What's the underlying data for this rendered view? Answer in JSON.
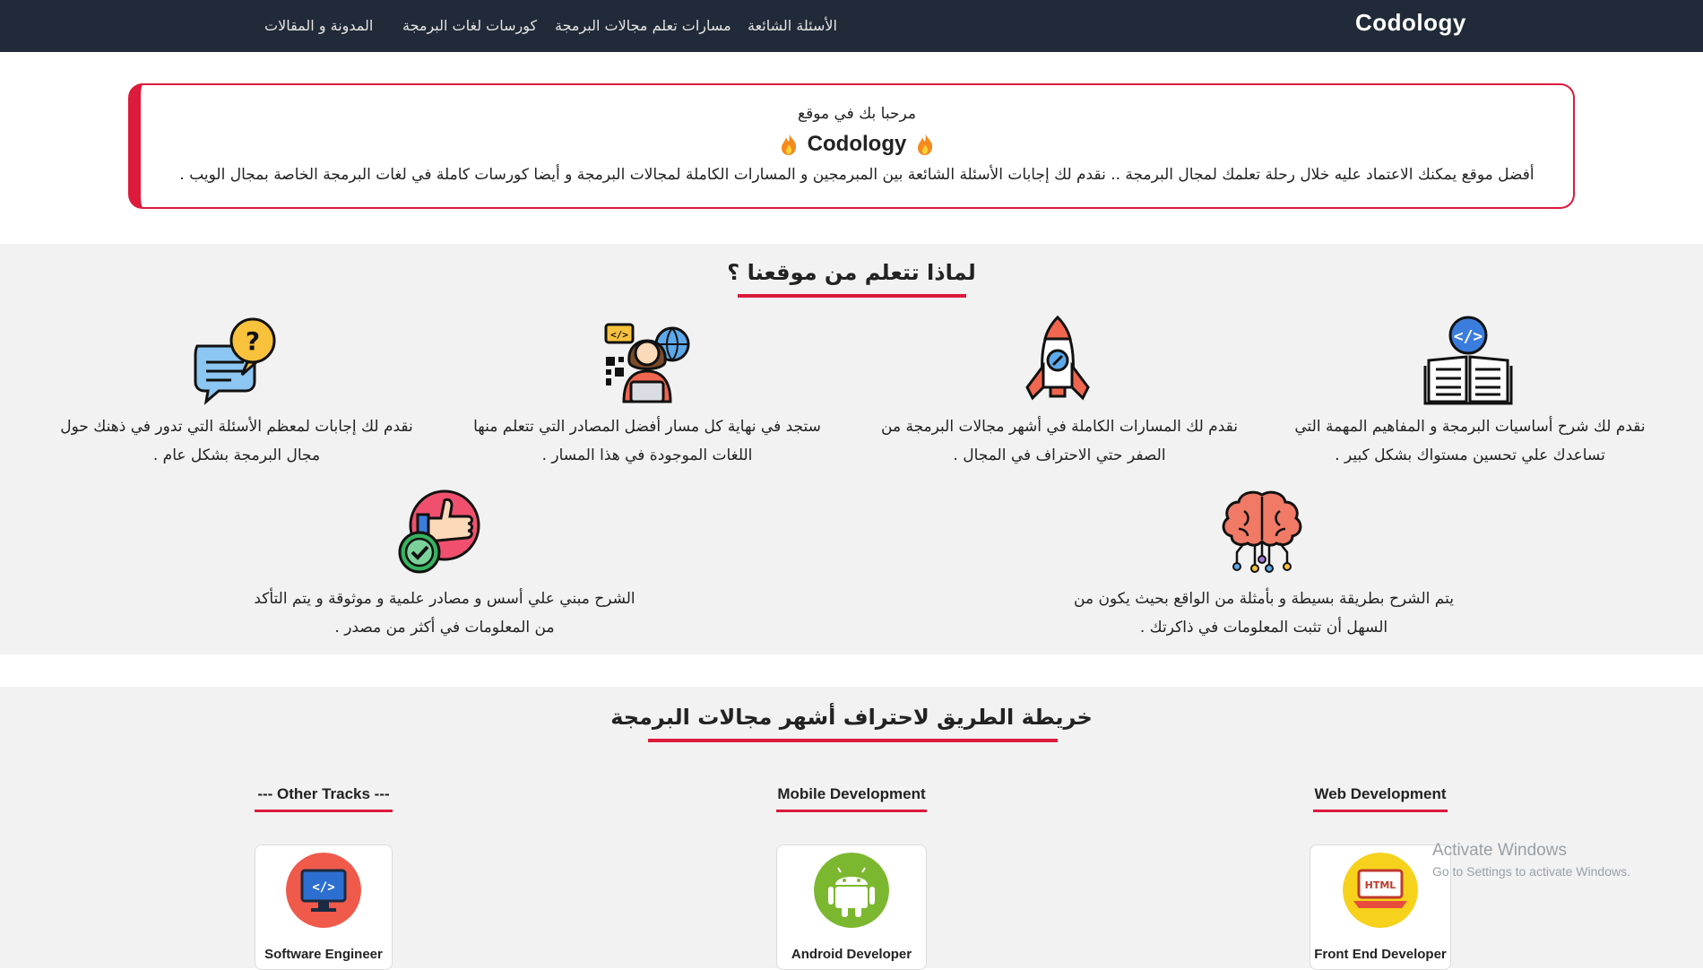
{
  "navbar": {
    "brand": "Codology",
    "links": [
      "الأسئلة الشائعة",
      "مسارات تعلم مجالات البرمجة",
      "كورسات لغات البرمجة",
      "المدونة و المقالات"
    ]
  },
  "welcome": {
    "line1": "مرحبا بك في موقع",
    "site_name": "Codology",
    "line3": "أفضل موقع يمكنك الاعتماد عليه خلال رحلة تعلمك لمجال البرمجة .. نقدم لك إجابات الأسئلة الشائعة بين المبرمجين و المسارات الكاملة لمجالات البرمجة و أيضا كورسات كاملة في لغات البرمجة الخاصة بمجال الويب ."
  },
  "why": {
    "title": "لماذا تتعلم من موقعنا ؟",
    "features": [
      {
        "icon": "open-book-code-icon",
        "line1": "نقدم لك شرح أساسيات البرمجة و المفاهيم المهمة التي",
        "line2": "تساعدك علي تحسين مستواك بشكل كبير ."
      },
      {
        "icon": "rocket-icon",
        "line1": "نقدم لك المسارات الكاملة في أشهر مجالات البرمجة من",
        "line2": "الصفر حتي الاحتراف في المجال ."
      },
      {
        "icon": "programmer-icon",
        "line1": "ستجد في نهاية كل مسار أفضل المصادر التي تتعلم منها",
        "line2": "اللغات الموجودة في هذا المسار ."
      },
      {
        "icon": "question-chat-icon",
        "line1": "نقدم لك إجابات لمعظم الأسئلة التي تدور في ذهنك حول",
        "line2": "مجال البرمجة بشكل عام ."
      },
      {
        "icon": "brain-circuit-icon",
        "line1": "يتم الشرح بطريقة بسيطة و بأمثلة من الواقع بحيث يكون من",
        "line2": "السهل أن تثبت المعلومات في ذاكرتك ."
      },
      {
        "icon": "thumbs-up-check-icon",
        "line1": "الشرح مبني علي أسس و مصادر علمية و موثوقة و يتم التأكد",
        "line2": "من المعلومات في أكثر من مصدر ."
      }
    ]
  },
  "roadmap": {
    "title": "خريطة الطريق لاحتراف أشهر مجالات البرمجة",
    "tracks": [
      {
        "title": "Web Development",
        "card": "Front End Developer",
        "icon": "html-laptop-icon"
      },
      {
        "title": "Mobile Development",
        "card": "Android Developer",
        "icon": "android-icon"
      },
      {
        "title": "--- Other Tracks ---",
        "card": "Software Engineer",
        "icon": "monitor-code-icon"
      }
    ]
  },
  "watermark": {
    "line1": "Activate Windows",
    "line2": "Go to Settings to activate Windows."
  }
}
